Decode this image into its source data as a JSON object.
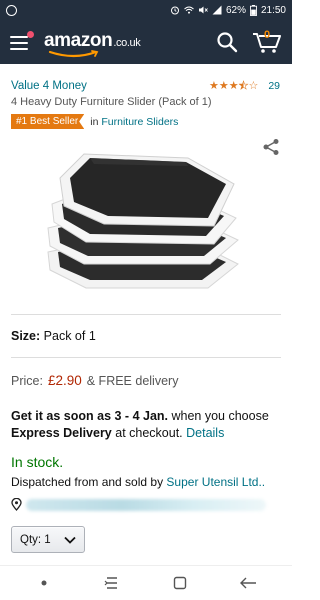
{
  "status_bar": {
    "battery": "62%",
    "time": "21:50"
  },
  "header": {
    "logo_text": "amazon",
    "logo_tld": ".co.uk",
    "cart_count": "0"
  },
  "product": {
    "brand": "Value 4 Money",
    "rating_value": 3.5,
    "rating_count": "29",
    "title": "4 Heavy Duty Furniture Slider (Pack of 1)",
    "badge": "#1 Best Seller",
    "badge_in": "in",
    "badge_category": "Furniture Sliders"
  },
  "size": {
    "label": "Size:",
    "value": "Pack of 1"
  },
  "price": {
    "label": "Price:",
    "amount": "£2.90",
    "delivery": "& FREE delivery"
  },
  "delivery": {
    "get_it": "Get it as soon as 3 - 4 Jan.",
    "when": " when you choose ",
    "express": "Express Delivery",
    "at_checkout": " at checkout. ",
    "details": "Details"
  },
  "stock": {
    "status": "In stock.",
    "dispatch_prefix": "Dispatched from and sold by ",
    "seller": "Super Utensil Ltd.."
  },
  "quantity": {
    "label": "Qty: 1"
  },
  "colors": {
    "header_bg": "#232f3e",
    "link": "#007185",
    "price": "#b12704",
    "in_stock": "#007600",
    "badge": "#e47911",
    "star": "#de7921"
  }
}
